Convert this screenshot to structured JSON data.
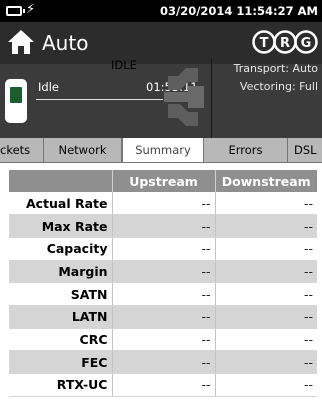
{
  "status_bar": {
    "battery_icon": "battery-icon",
    "charge_icon": "lightning-icon",
    "datetime": "03/20/2014 11:54:27 AM"
  },
  "title_bar": {
    "home_icon": "home-icon",
    "title": "Auto",
    "logo_text": [
      "T",
      "R",
      "G"
    ]
  },
  "connection": {
    "device_icon": "modem-device-icon",
    "state_title": "IDLE",
    "state_label": "Idle",
    "elapsed": "01:53:11",
    "splitter_icon": "line-splitter-icon",
    "transport": "Transport: Auto",
    "vectoring": "Vectoring: Full"
  },
  "tabs": [
    {
      "label": "ckets",
      "active": false
    },
    {
      "label": "Network",
      "active": false
    },
    {
      "label": "Summary",
      "active": true
    },
    {
      "label": "Errors",
      "active": false
    },
    {
      "label": "DSL",
      "active": false
    }
  ],
  "summary_table": {
    "headers": [
      "",
      "Upstream",
      "Downstream"
    ],
    "rows": [
      {
        "label": "Actual Rate",
        "up": "--",
        "down": "--"
      },
      {
        "label": "Max Rate",
        "up": "--",
        "down": "--"
      },
      {
        "label": "Capacity",
        "up": "--",
        "down": "--"
      },
      {
        "label": "Margin",
        "up": "--",
        "down": "--"
      },
      {
        "label": "SATN",
        "up": "--",
        "down": "--"
      },
      {
        "label": "LATN",
        "up": "--",
        "down": "--"
      },
      {
        "label": "CRC",
        "up": "--",
        "down": "--"
      },
      {
        "label": "FEC",
        "up": "--",
        "down": "--"
      },
      {
        "label": "RTX-UC",
        "up": "--",
        "down": "--"
      }
    ]
  },
  "colors": {
    "title_bar": "#2c2c2c",
    "panel": "#3b3b3b",
    "table_header": "#8f8f8f",
    "row_shade": "#d5d5d5"
  }
}
